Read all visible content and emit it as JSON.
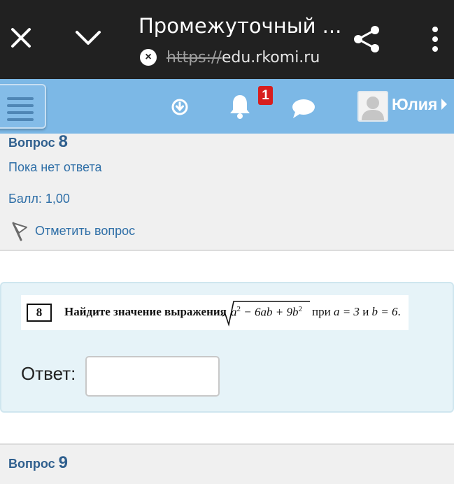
{
  "browser": {
    "title": "Промежуточный ...",
    "url_scheme": "https://",
    "url_host": "edu.rkomi.ru",
    "icons": [
      "close-icon",
      "chevron-down-icon",
      "share-icon",
      "more-vert-icon"
    ]
  },
  "header": {
    "notifications_count": "1",
    "user_name": "Юлия",
    "accent_color": "#7cb8e6",
    "icons": [
      "hamburger-menu-icon",
      "download-icon",
      "bell-icon",
      "chat-icon",
      "avatar",
      "caret-right-icon"
    ]
  },
  "question8_info": {
    "title": "Вопрос",
    "number": "8",
    "state": "Пока нет ответа",
    "grade": "Балл: 1,00",
    "flag_label": "Отметить вопрос"
  },
  "question8": {
    "task_number": "8",
    "task_text": "Найдите значение выражения",
    "expr_a": "a",
    "expr_exp1": "2",
    "expr_middle": " − 6ab + 9b",
    "expr_exp2": "2",
    "cond_word": "при",
    "cond_a": "a = 3",
    "cond_and": "и",
    "cond_b": "b = 6",
    "cond_end": ".",
    "answer_label": "Ответ:",
    "answer_value": ""
  },
  "question9": {
    "title": "Вопрос",
    "number": "9"
  }
}
